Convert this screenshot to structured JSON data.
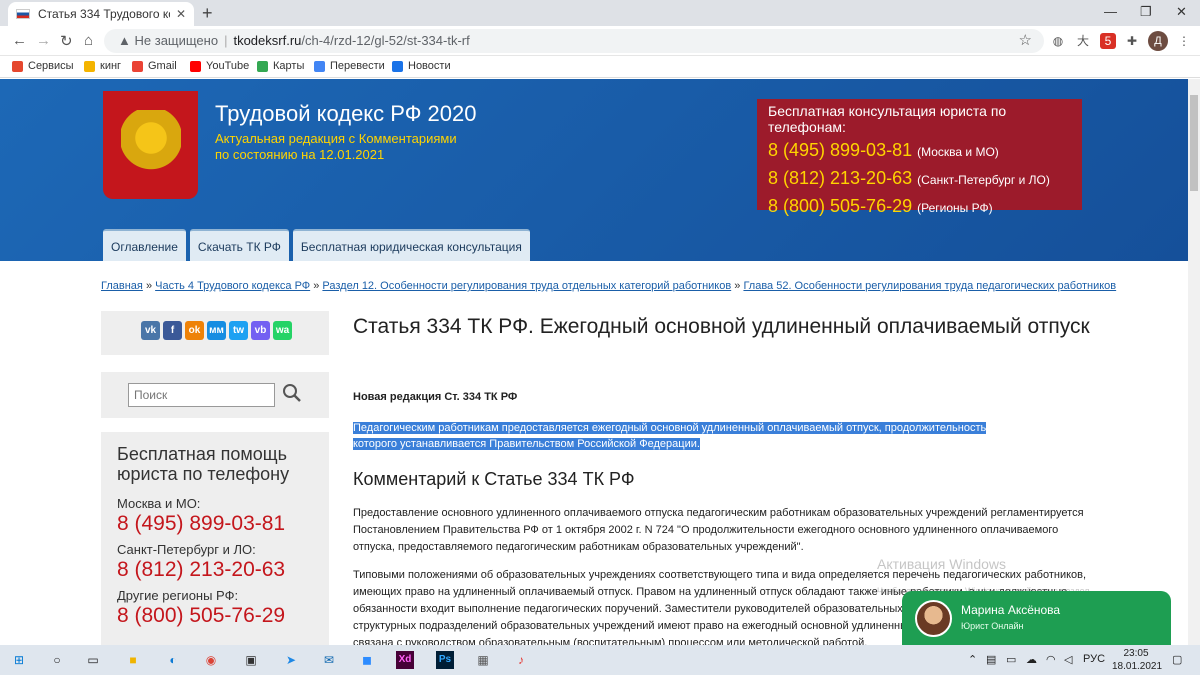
{
  "browser": {
    "tab_title": "Статья 334 Трудового кодекса Р",
    "tab_close": "✕",
    "new_tab": "+",
    "not_secure": "Не защищено",
    "host": "tkodeksrf.ru",
    "path": "/ch-4/rzd-12/gl-52/st-334-tk-rf",
    "profile_initial": "Д",
    "ext_badge": "5",
    "bookmarks": [
      "Сервисы",
      "кинг",
      "Gmail",
      "YouTube",
      "Карты",
      "Перевести",
      "Новости"
    ]
  },
  "header": {
    "title": "Трудовой кодекс РФ 2020",
    "subtitle_1": "Актуальная редакция с Комментариями",
    "subtitle_2": "по состоянию на 12.01.2021",
    "consult_heading": "Бесплатная консультация юриста по телефонам:",
    "phones": [
      {
        "number": "8 (495) 899-03-81",
        "region": "(Москва и МО)"
      },
      {
        "number": "8 (812) 213-20-63",
        "region": "(Санкт-Петербург и ЛО)"
      },
      {
        "number": "8 (800) 505-76-29",
        "region": "(Регионы РФ)"
      }
    ],
    "menu": [
      "Оглавление",
      "Скачать ТК РФ",
      "Бесплатная юридическая консультация"
    ]
  },
  "breadcrumb": {
    "items": [
      "Главная",
      "Часть 4 Трудового кодекса РФ",
      "Раздел 12. Особенности регулирования труда отдельных категорий работников",
      "Глава 52. Особенности регулирования труда педагогических работников"
    ],
    "separator": "»"
  },
  "sidebar": {
    "share_icons": [
      "vk",
      "f",
      "ok",
      "мм",
      "tw",
      "vb",
      "wa"
    ],
    "search_placeholder": "Поиск",
    "help_heading": "Бесплатная помощь юриста по телефону",
    "contacts": [
      {
        "label": "Москва и МО:",
        "phone": "8 (495) 899-03-81"
      },
      {
        "label": "Санкт-Петербург и ЛО:",
        "phone": "8 (812) 213-20-63"
      },
      {
        "label": "Другие регионы РФ:",
        "phone": "8 (800) 505-76-29"
      }
    ]
  },
  "article": {
    "title": "Статья 334 ТК РФ. Ежегодный основной удлиненный оплачиваемый отпуск",
    "new_edition": "Новая редакция Ст. 334 ТК РФ",
    "highlighted_text": "Педагогическим работникам предоставляется ежегодный основной удлиненный оплачиваемый отпуск, продолжительность которого устанавливается Правительством Российской Федерации.",
    "comment_heading": "Комментарий к Статье 334 ТК РФ",
    "para_1": "Предоставление основного удлиненного оплачиваемого отпуска педагогическим работникам образовательных учреждений регламентируется Постановлением Правительства РФ от 1 октября 2002 г. N 724 \"О продолжительности ежегодного основного удлиненного оплачиваемого отпуска, предоставляемого педагогическим работникам образовательных учреждений\".",
    "para_2": "Типовыми положениями об образовательных учреждениях соответствующего типа и вида определяется перечень педагогических работников, имеющих право на удлиненный оплачиваемый отпуск. Правом на удлиненный отпуск обладают также иные работники, в чьи должностные обязанности входит выполнение педагогических поручений. Заместители руководителей образовательных учреждений и руководители структурных подразделений образовательных учреждений имеют право на ежегодный основной удлиненный отпуск, если их деятельность связана с руководством образовательным (воспитательным) процессом или методической работой."
  },
  "watermark": {
    "title": "Активация Windows",
    "hint": "Чтобы активировать Windows, перейдите в раздел"
  },
  "chat": {
    "name": "Марина Аксёнова",
    "role": "Юрист Онлайн"
  },
  "taskbar": {
    "lang": "РУС",
    "time": "23:05",
    "date": "18.01.2021"
  },
  "colors": {
    "header_blue": "#1a5ea8",
    "consult_red": "#9c1b2b",
    "phone_yellow": "#ffd400",
    "sidebar_phone_red": "#c4161c",
    "chat_green": "#1e9e52",
    "highlight_blue": "#3a7fd9"
  }
}
